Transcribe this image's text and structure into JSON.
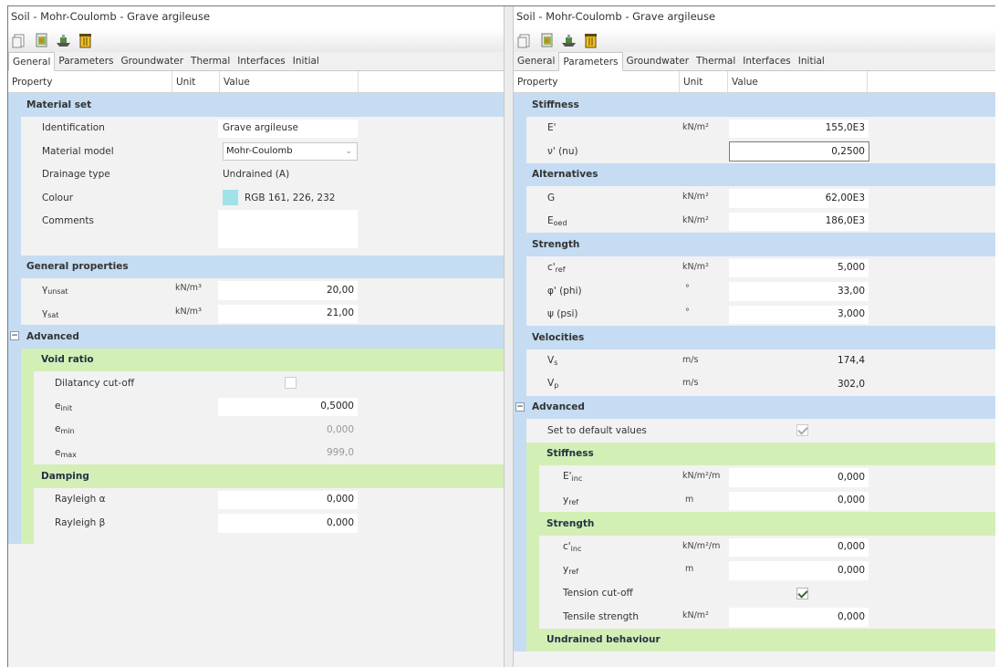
{
  "left": {
    "title": "Soil - Mohr-Coulomb - Grave argileuse",
    "toolbar_icons": [
      "new-doc-icon",
      "open-database-icon",
      "ship-icon",
      "trash-icon"
    ],
    "tabs": [
      "General",
      "Parameters",
      "Groundwater",
      "Thermal",
      "Interfaces",
      "Initial"
    ],
    "active_tab": "General",
    "columns": {
      "property": "Property",
      "unit": "Unit",
      "value": "Value"
    },
    "material_set": {
      "heading": "Material set",
      "identification_label": "Identification",
      "identification_value": "Grave argileuse",
      "model_label": "Material model",
      "model_value": "Mohr-Coulomb",
      "drainage_label": "Drainage type",
      "drainage_value": "Undrained (A)",
      "colour_label": "Colour",
      "colour_value": "RGB 161, 226, 232",
      "colour_swatch": "#a1e2e8",
      "comments_label": "Comments"
    },
    "general_properties": {
      "heading": "General properties",
      "gamma_unsat": {
        "symbol": "γ",
        "sub": "unsat",
        "unit": "kN/m³",
        "value": "20,00"
      },
      "gamma_sat": {
        "symbol": "γ",
        "sub": "sat",
        "unit": "kN/m³",
        "value": "21,00"
      }
    },
    "advanced": {
      "heading": "Advanced",
      "void_ratio": "Void ratio",
      "dilatancy_label": "Dilatancy cut-off",
      "e_init": {
        "symbol": "e",
        "sub": "init",
        "value": "0,5000"
      },
      "e_min": {
        "symbol": "e",
        "sub": "min",
        "value": "0,000"
      },
      "e_max": {
        "symbol": "e",
        "sub": "max",
        "value": "999,0"
      },
      "damping": "Damping",
      "rayleigh_alpha": {
        "label": "Rayleigh α",
        "value": "0,000"
      },
      "rayleigh_beta": {
        "label": "Rayleigh β",
        "value": "0,000"
      }
    }
  },
  "right": {
    "title": "Soil - Mohr-Coulomb - Grave argileuse",
    "tabs": [
      "General",
      "Parameters",
      "Groundwater",
      "Thermal",
      "Interfaces",
      "Initial"
    ],
    "active_tab": "Parameters",
    "columns": {
      "property": "Property",
      "unit": "Unit",
      "value": "Value"
    },
    "stiffness": {
      "heading": "Stiffness",
      "e_prime": {
        "symbol": "E'",
        "unit": "kN/m²",
        "value": "155,0E3"
      },
      "nu": {
        "label": "ν' (nu)",
        "value": "0,2500"
      }
    },
    "alternatives": {
      "heading": "Alternatives",
      "g": {
        "symbol": "G",
        "unit": "kN/m²",
        "value": "62,00E3"
      },
      "e_oed": {
        "symbol": "E",
        "sub": "oed",
        "unit": "kN/m²",
        "value": "186,0E3"
      }
    },
    "strength": {
      "heading": "Strength",
      "c_ref": {
        "symbol": "c'",
        "sub": "ref",
        "unit": "kN/m²",
        "value": "5,000"
      },
      "phi": {
        "label": "φ' (phi)",
        "unit": "°",
        "value": "33,00"
      },
      "psi": {
        "label": "ψ (psi)",
        "unit": "°",
        "value": "3,000"
      }
    },
    "velocities": {
      "heading": "Velocities",
      "vs": {
        "symbol": "V",
        "sub": "s",
        "unit": "m/s",
        "value": "174,4"
      },
      "vp": {
        "symbol": "V",
        "sub": "p",
        "unit": "m/s",
        "value": "302,0"
      }
    },
    "advanced": {
      "heading": "Advanced",
      "default_label": "Set to default values",
      "stiffness_heading": "Stiffness",
      "e_inc": {
        "symbol": "E'",
        "sub": "inc",
        "unit": "kN/m²/m",
        "value": "0,000"
      },
      "y_ref1": {
        "symbol": "y",
        "sub": "ref",
        "unit": "m",
        "value": "0,000"
      },
      "strength_heading": "Strength",
      "c_inc": {
        "symbol": "c'",
        "sub": "inc",
        "unit": "kN/m²/m",
        "value": "0,000"
      },
      "y_ref2": {
        "symbol": "y",
        "sub": "ref",
        "unit": "m",
        "value": "0,000"
      },
      "tension_label": "Tension cut-off",
      "tensile": {
        "label": "Tensile strength",
        "unit": "kN/m²",
        "value": "0,000"
      },
      "undrained_heading": "Undrained behaviour"
    }
  }
}
